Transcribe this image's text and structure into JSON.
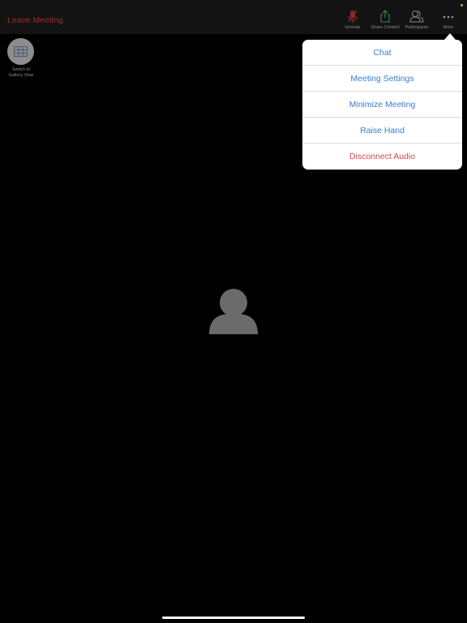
{
  "topbar": {
    "leave_label": "Leave Meeting",
    "buttons": [
      {
        "icon": "muted-mic-icon",
        "label": "Unmute"
      },
      {
        "icon": "share-icon",
        "label": "Share Content"
      },
      {
        "icon": "participants-icon",
        "label": "Participants"
      },
      {
        "icon": "more-icon",
        "label": "More"
      }
    ]
  },
  "gallery": {
    "label": "Switch to\nGallery View"
  },
  "menu": {
    "items": [
      {
        "label": "Chat"
      },
      {
        "label": "Meeting Settings"
      },
      {
        "label": "Minimize Meeting"
      },
      {
        "label": "Raise Hand"
      },
      {
        "label": "Disconnect Audio"
      }
    ]
  },
  "colors": {
    "accent": "#3b7bd0",
    "danger": "#d04a4a",
    "leave": "#9b2b2b",
    "share": "#3f8a3f"
  }
}
